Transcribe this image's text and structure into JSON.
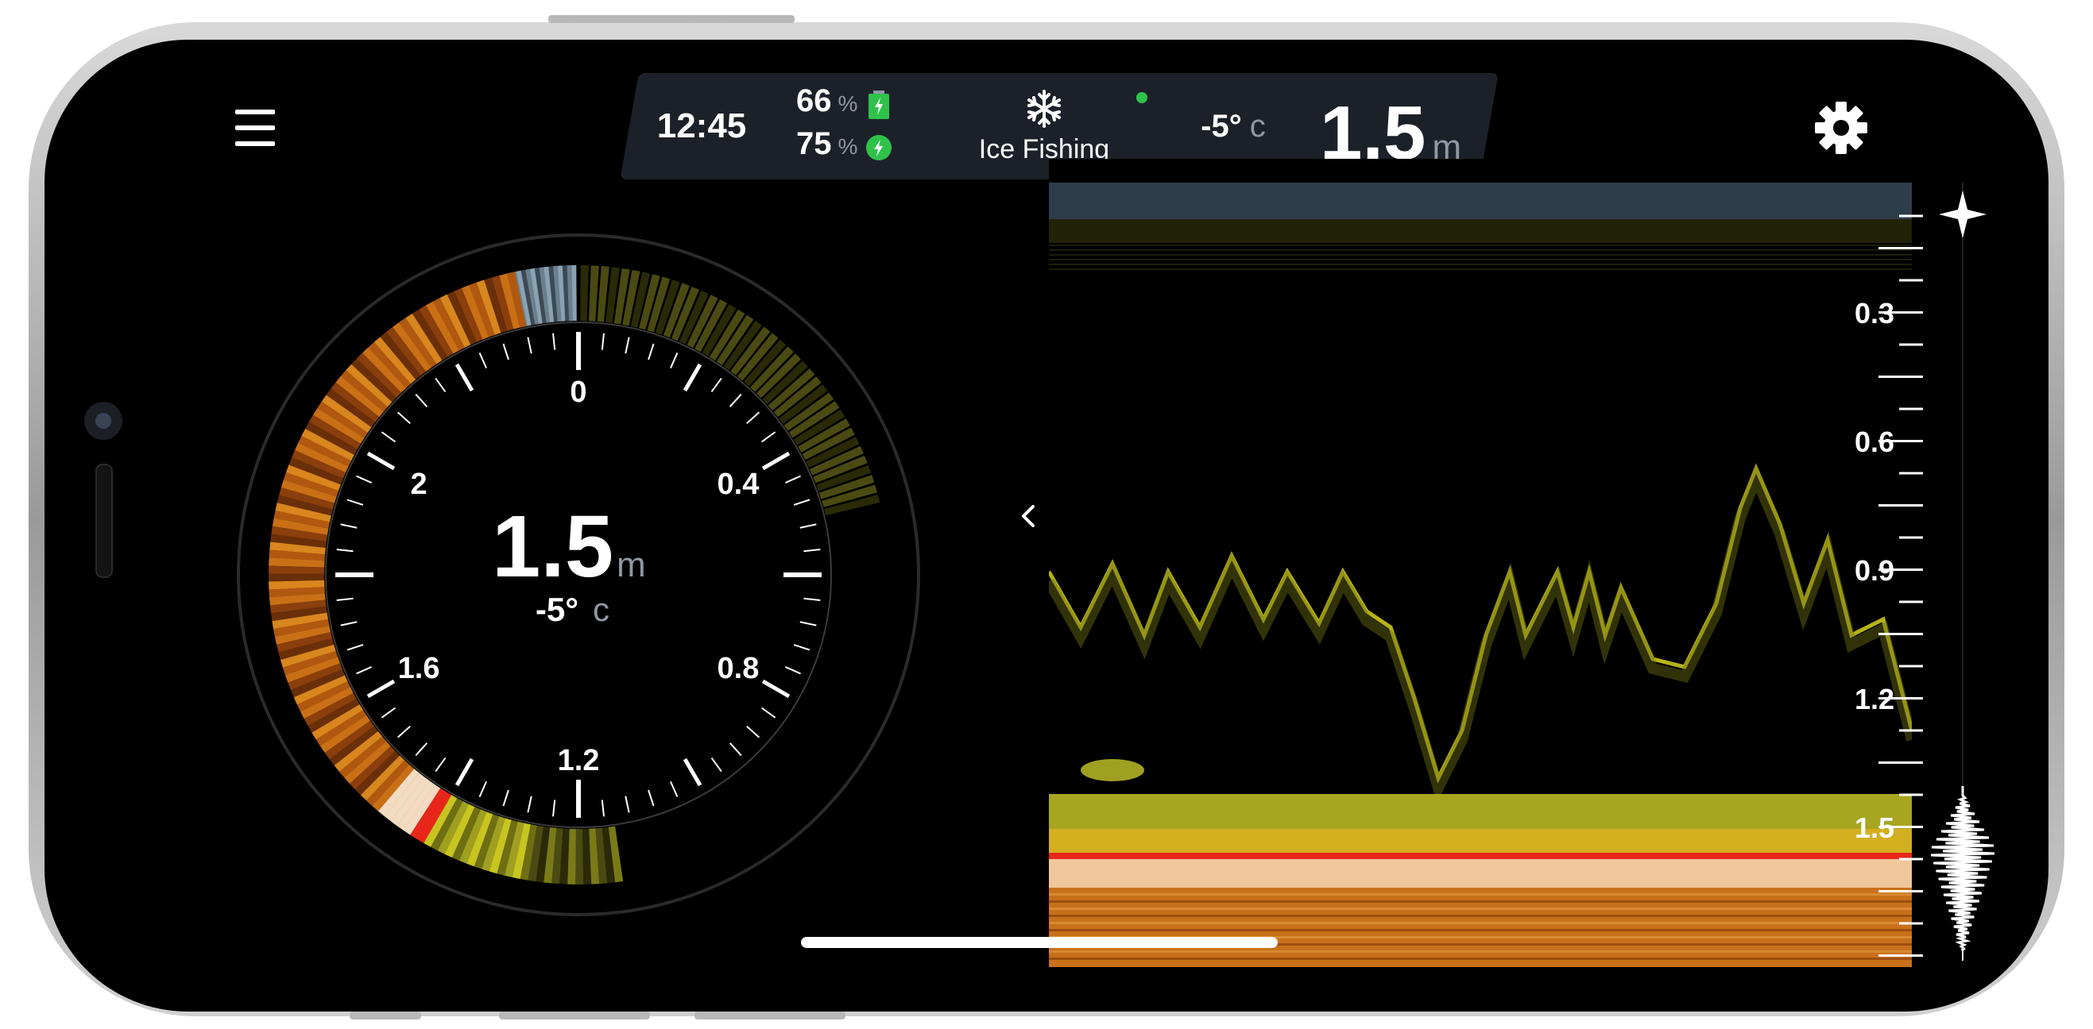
{
  "status_bar": {
    "time": "12:45",
    "battery_device_value": "66",
    "battery_device_unit": "%",
    "battery_phone_value": "75",
    "battery_phone_unit": "%",
    "mode_icon": "snowflake-icon",
    "mode_label": "Ice Fishing",
    "temperature_value": "-5°",
    "temperature_unit": "c",
    "depth_value": "1.5",
    "depth_unit": "m"
  },
  "flasher": {
    "depth_value": "1.5",
    "depth_unit": "m",
    "temp_value": "-5°",
    "temp_unit": "c",
    "dial_labels": [
      "0",
      "0.4",
      "0.8",
      "1.2",
      "1.6",
      "2"
    ]
  },
  "sonar": {
    "depth_scale": [
      "0.3",
      "0.6",
      "0.9",
      "1.2",
      "1.5"
    ]
  },
  "colors": {
    "background": "#000000",
    "pill_background": "#1c2129",
    "unit_text": "#8f97a3",
    "connection_ok": "#2fc24a",
    "battery_green": "#2fc24a",
    "sonar_yellow": "#d6d21c",
    "sonar_orange": "#d9781c",
    "sonar_red": "#e8261a"
  },
  "icons": {
    "menu": "menu-icon",
    "settings": "gear-icon",
    "battery": "battery-icon",
    "phone_battery": "phone-battery-icon",
    "pan_arrows": "chevron-left-right-icon"
  }
}
